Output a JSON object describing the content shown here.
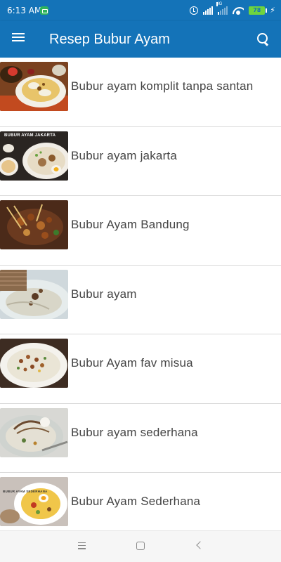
{
  "status_bar": {
    "time": "6:13 AM",
    "network_label": "4G",
    "battery_level": "78"
  },
  "app_bar": {
    "title": "Resep Bubur Ayam"
  },
  "recipes": [
    {
      "title": "Bubur ayam komplit tanpa santan",
      "thumb_caption": ""
    },
    {
      "title": "Bubur ayam jakarta",
      "thumb_caption": "BUBUR AYAM JAKARTA"
    },
    {
      "title": "Bubur Ayam Bandung",
      "thumb_caption": ""
    },
    {
      "title": "Bubur ayam",
      "thumb_caption": ""
    },
    {
      "title": "Bubur Ayam fav misua",
      "thumb_caption": ""
    },
    {
      "title": "Bubur ayam sederhana",
      "thumb_caption": ""
    },
    {
      "title": "Bubur Ayam Sederhana",
      "thumb_caption": "BUBUR AYAM SEDERHANA"
    }
  ],
  "icons": {
    "menu": "menu-icon",
    "search": "search-icon",
    "nav_recent": "recent-apps-icon",
    "nav_home": "home-icon",
    "nav_back": "back-icon"
  },
  "colors": {
    "primary": "#1473b8",
    "divider": "#d8d8d8",
    "text": "#444444",
    "battery": "#6fd43e"
  }
}
